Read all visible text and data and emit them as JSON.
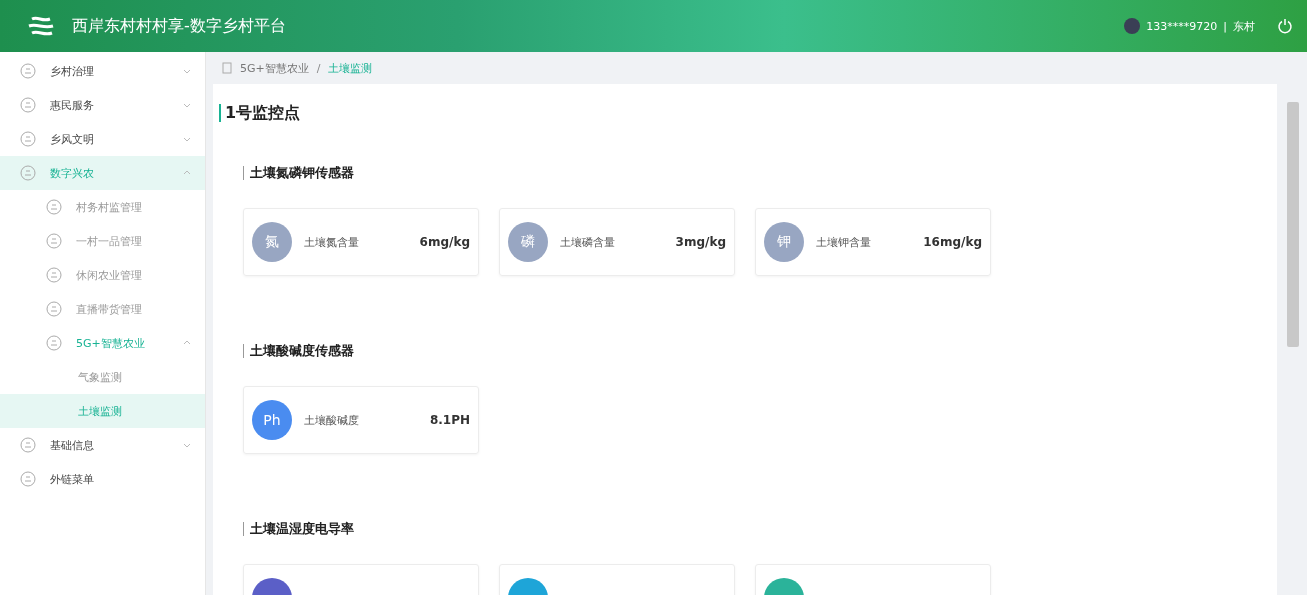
{
  "header": {
    "title": "西岸东村村村享-数字乡村平台",
    "user": "133****9720",
    "separator": "|",
    "role": "东村"
  },
  "sidebar": {
    "items": [
      {
        "label": "乡村治理",
        "selected": false,
        "expanded": false
      },
      {
        "label": "惠民服务",
        "selected": false,
        "expanded": false
      },
      {
        "label": "乡风文明",
        "selected": false,
        "expanded": false
      },
      {
        "label": "数字兴农",
        "selected": true,
        "expanded": true,
        "children": [
          {
            "label": "村务村监管理",
            "selected": false
          },
          {
            "label": "一村一品管理",
            "selected": false
          },
          {
            "label": "休闲农业管理",
            "selected": false
          },
          {
            "label": "直播带货管理",
            "selected": false
          },
          {
            "label": "5G+智慧农业",
            "selected": true,
            "expanded": true,
            "children": [
              {
                "label": "气象监测",
                "selected": false
              },
              {
                "label": "土壤监测",
                "selected": true
              }
            ]
          }
        ]
      },
      {
        "label": "基础信息",
        "selected": false,
        "expanded": false
      },
      {
        "label": "外链菜单",
        "selected": false
      }
    ]
  },
  "breadcrumb_separator": "/",
  "breadcrumb": [
    {
      "label": "5G+智慧农业",
      "selected": false
    },
    {
      "label": "土壤监测",
      "selected": true
    }
  ],
  "page_title": "1号监控点",
  "sections": [
    {
      "title": "土壤氮磷钾传感器",
      "cards": [
        {
          "icon_text": "氮",
          "label": "土壤氮含量",
          "value": "6mg/kg",
          "color": "#98a6c2"
        },
        {
          "icon_text": "磷",
          "label": "土壤磷含量",
          "value": "3mg/kg",
          "color": "#98a6c2"
        },
        {
          "icon_text": "钾",
          "label": "土壤钾含量",
          "value": "16mg/kg",
          "color": "#98a6c2"
        }
      ]
    },
    {
      "title": "土壤酸碱度传感器",
      "cards": [
        {
          "icon_text": "Ph",
          "label": "土壤酸碱度",
          "value": "8.1PH",
          "color": "#4a8cf0"
        }
      ]
    },
    {
      "title": "土壤温湿度电导率",
      "cards": [
        {
          "color": "#5b5fc7"
        },
        {
          "color": "#1ea5d8"
        },
        {
          "color": "#2bb39a"
        }
      ]
    }
  ]
}
